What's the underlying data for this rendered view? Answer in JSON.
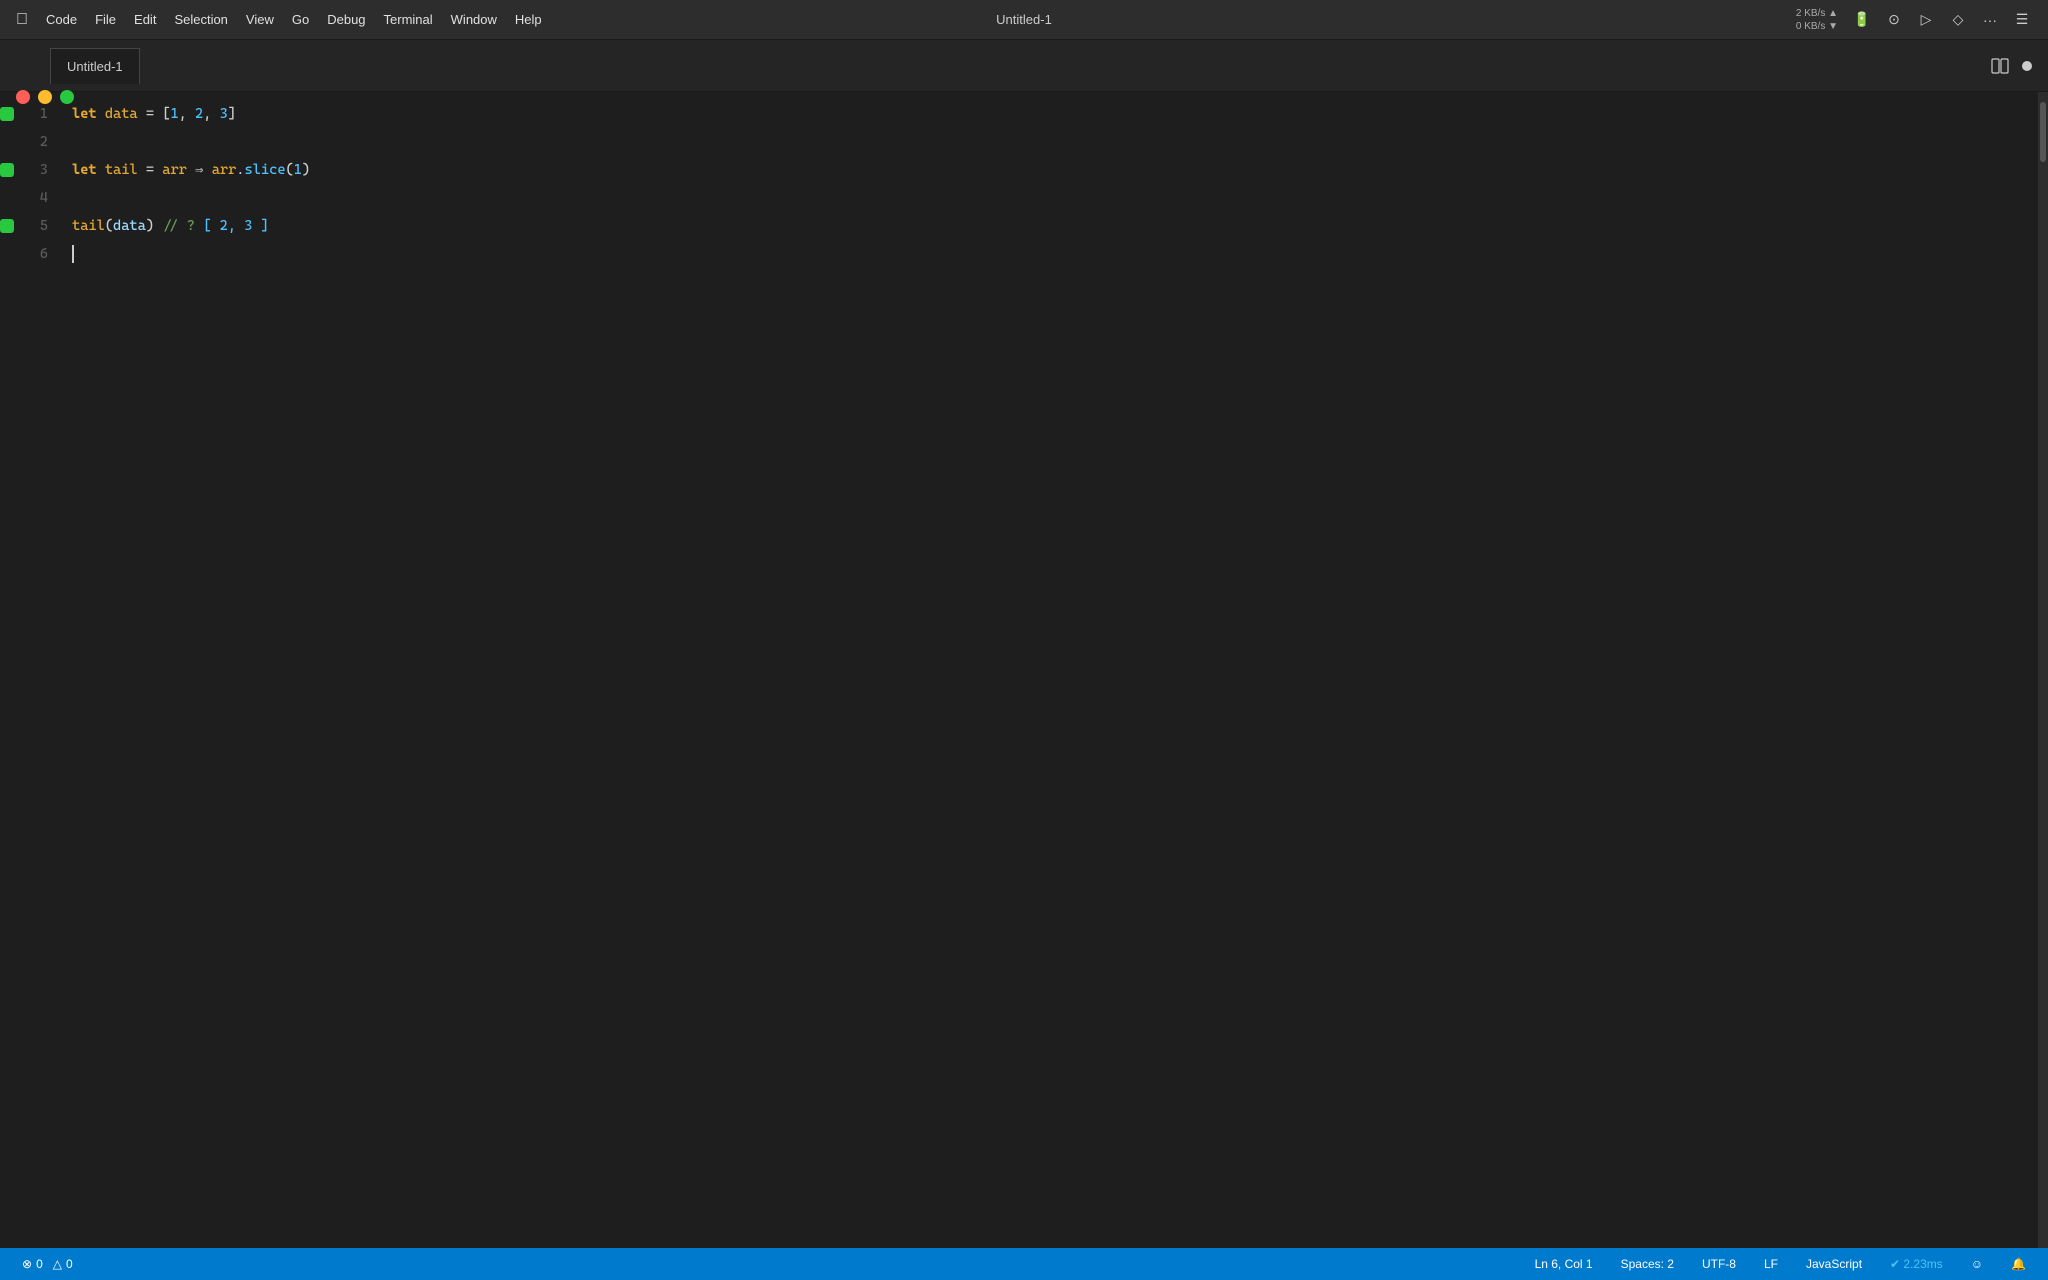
{
  "titlebar": {
    "apple_menu": "⌘",
    "menu_items": [
      "Code",
      "File",
      "Edit",
      "Selection",
      "View",
      "Go",
      "Debug",
      "Terminal",
      "Window",
      "Help"
    ],
    "title": "Untitled-1",
    "network_up": "2 KB/s ▲",
    "network_down": "0 KB/s ▼"
  },
  "tab": {
    "name": "Untitled-1"
  },
  "code": {
    "lines": [
      {
        "number": "1",
        "has_breakpoint": true,
        "content": ""
      },
      {
        "number": "2",
        "has_breakpoint": false,
        "content": ""
      },
      {
        "number": "3",
        "has_breakpoint": true,
        "content": ""
      },
      {
        "number": "4",
        "has_breakpoint": false,
        "content": ""
      },
      {
        "number": "5",
        "has_breakpoint": true,
        "content": ""
      },
      {
        "number": "6",
        "has_breakpoint": false,
        "content": ""
      }
    ]
  },
  "statusbar": {
    "errors": "0",
    "warnings": "0",
    "position": "Ln 6, Col 1",
    "spaces": "Spaces: 2",
    "encoding": "UTF-8",
    "line_ending": "LF",
    "language": "JavaScript",
    "timing": "✔ 2.23ms",
    "smiley": "☺",
    "bell": "🔔"
  }
}
